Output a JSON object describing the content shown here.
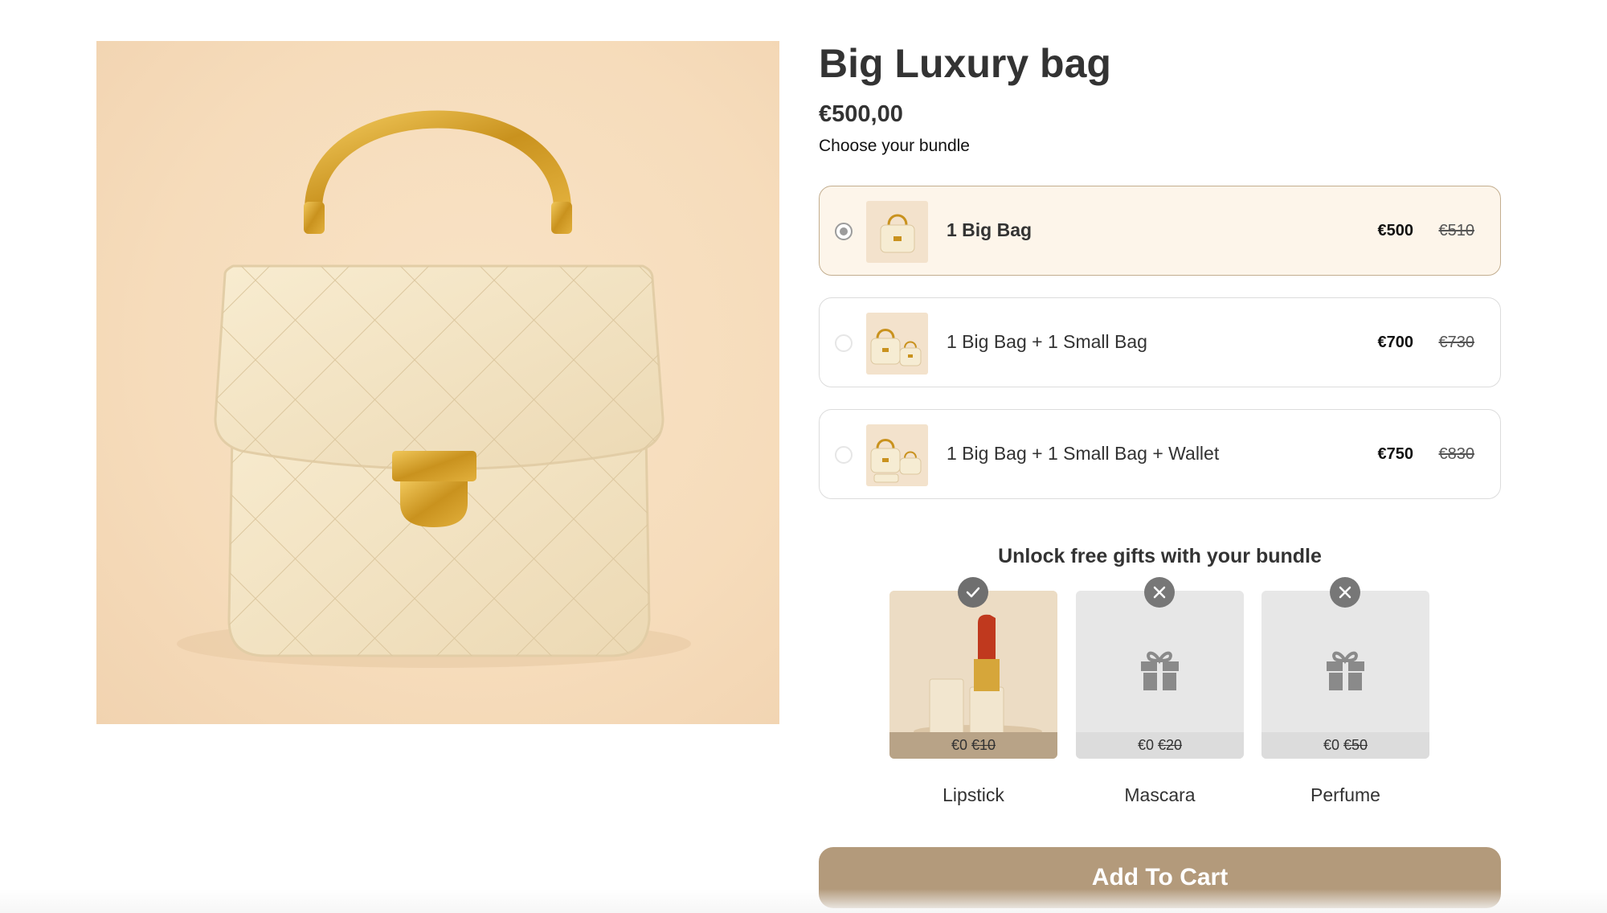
{
  "product": {
    "title": "Big Luxury bag",
    "price": "€500,00",
    "image_alt": "bag-image"
  },
  "bundle": {
    "heading": "Choose your bundle",
    "options": [
      {
        "label": "1 Big Bag",
        "price": "€500",
        "compare_price": "€510",
        "selected": true
      },
      {
        "label": "1 Big Bag + 1 Small Bag",
        "price": "€700",
        "compare_price": "€730",
        "selected": false
      },
      {
        "label": "1 Big Bag + 1 Small Bag + Wallet",
        "price": "€750",
        "compare_price": "€830",
        "selected": false
      }
    ]
  },
  "gifts": {
    "heading": "Unlock free gifts with your bundle",
    "items": [
      {
        "name": "Lipstick",
        "price": "€0",
        "compare_price": "€10",
        "status": "unlocked"
      },
      {
        "name": "Mascara",
        "price": "€0",
        "compare_price": "€20",
        "status": "locked"
      },
      {
        "name": "Perfume",
        "price": "€0",
        "compare_price": "€50",
        "status": "locked"
      }
    ]
  },
  "cart": {
    "button_label": "Add To Cart"
  },
  "colors": {
    "accent": "#b39a7b",
    "selected_bg": "#fdf5ea",
    "image_bg": "#f6dcbb"
  }
}
